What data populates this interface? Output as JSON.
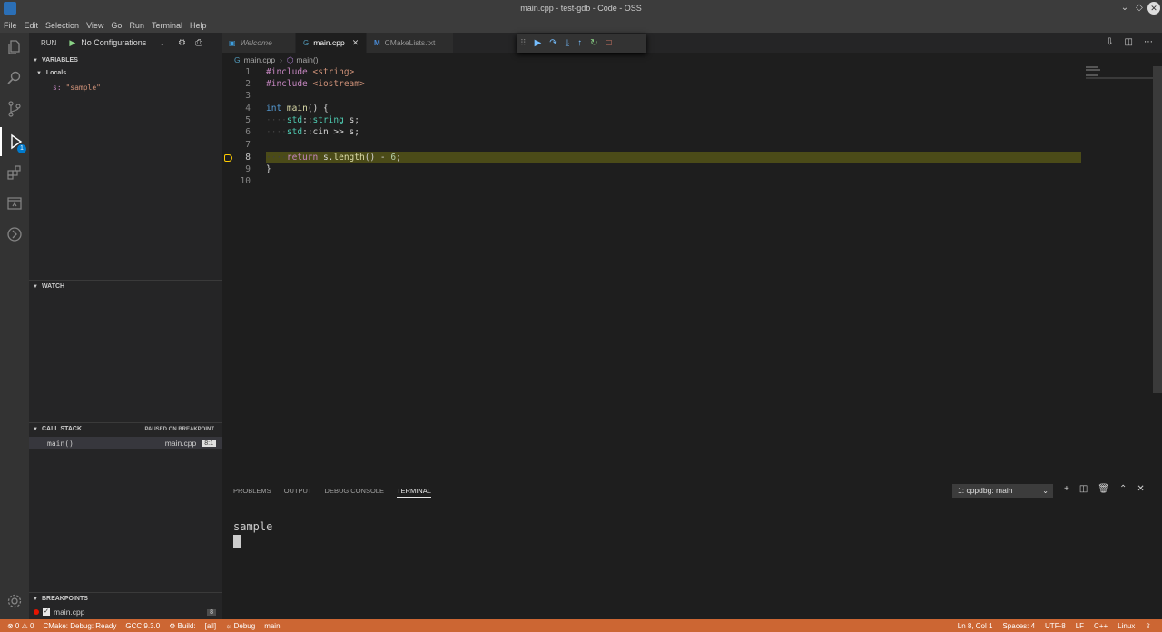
{
  "window": {
    "title": "main.cpp - test-gdb - Code - OSS"
  },
  "menu": [
    "File",
    "Edit",
    "Selection",
    "View",
    "Go",
    "Run",
    "Terminal",
    "Help"
  ],
  "run_bar": {
    "label": "RUN",
    "configuration": "No Configurations"
  },
  "sidebar": {
    "variables_header": "VARIABLES",
    "locals_label": "Locals",
    "local_var_name": "s",
    "local_var_value": "\"sample\"",
    "watch_header": "WATCH",
    "callstack_header": "CALL STACK",
    "callstack_status": "PAUSED ON BREAKPOINT",
    "frame_fn": "main()",
    "frame_file": "main.cpp",
    "frame_pos": "8:1",
    "breakpoints_header": "BREAKPOINTS",
    "bp_file": "main.cpp",
    "bp_count": "8",
    "debug_badge": "1"
  },
  "tabs": {
    "welcome": "Welcome",
    "main": "main.cpp",
    "cmake": "CMakeLists.txt"
  },
  "breadcrumbs": {
    "file": "main.cpp",
    "symbol": "main()"
  },
  "code_lines": {
    "l1": "1",
    "l2": "2",
    "l3": "3",
    "l4": "4",
    "l5": "5",
    "l6": "6",
    "l7": "7",
    "l8": "8",
    "l9": "9",
    "l10": "10"
  },
  "panel": {
    "tabs": [
      "PROBLEMS",
      "OUTPUT",
      "DEBUG CONSOLE",
      "TERMINAL"
    ],
    "terminal_select": "1: cppdbg: main",
    "terminal_output": "sample"
  },
  "statusbar": {
    "problems": "⊗ 0 ⚠ 0",
    "cmake": "CMake: Debug: Ready",
    "compiler": "GCC 9.3.0",
    "build": "⚙ Build:",
    "build_target": "[all]",
    "debug": "☼ Debug",
    "launch_target": "main",
    "position": "Ln 8, Col 1",
    "spaces": "Spaces: 4",
    "encoding": "UTF-8",
    "eol": "LF",
    "language": "C++",
    "os": "Linux"
  },
  "colors": {
    "statusbar": "#cc6633",
    "current_line": "#4b4b18",
    "accent": "#007acc"
  }
}
